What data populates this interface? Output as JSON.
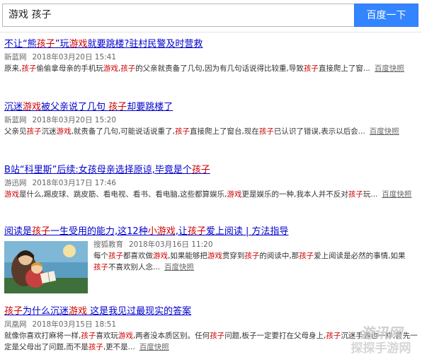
{
  "search": {
    "query": "游戏 孩子",
    "button_label": "百度一下"
  },
  "results": [
    {
      "title_parts": [
        "不让“熊",
        "孩子",
        "”玩",
        "游戏",
        "就要跳楼?驻村民警及时营救"
      ],
      "source": "新蓝网",
      "date": "2018年03月20日 15:41",
      "desc_parts": [
        "原来,",
        "孩子",
        "偷偷拿母亲的手机玩",
        "游戏",
        ",",
        "孩子",
        "的父亲就责备了几句,因为有几句话说得比较重,导致",
        "孩子",
        "直接爬上了窗..."
      ],
      "snapshot": "百度快照"
    },
    {
      "title_parts": [
        "沉迷",
        "游戏",
        "被父亲说了几句 ",
        "孩子",
        "却要跳楼了"
      ],
      "source": "新蓝网",
      "date": "2018年03月20日 15:20",
      "desc_parts": [
        "父亲见",
        "孩子",
        "沉迷",
        "游戏",
        ",就责备了几句,可能说话说重了,",
        "孩子",
        "直接爬上了窗台,现在",
        "孩子",
        "已认识了错误,表示以后会..."
      ],
      "snapshot": "百度快照"
    },
    {
      "title_parts": [
        "B站“科里斯”后续:女孩母亲选择原谅,毕竟是个",
        "孩子"
      ],
      "source": "游迅网",
      "date": "2018年03月17日 17:46",
      "desc_parts": [
        "游戏",
        "是什么,踢皮球、跳皮筋、看电视、看书、看电脑,这些都算娱乐,",
        "游戏",
        "更是娱乐的一种,我本人并不反对",
        "孩子",
        "玩..."
      ],
      "snapshot": "百度快照"
    },
    {
      "title_parts": [
        "阅读是",
        "孩子",
        "一生受用的能力,这12种",
        "小游戏",
        ",让",
        "孩子",
        "爱上阅读 | 方法指导"
      ],
      "source": "搜狐教育",
      "date": "2018年03月16日 11:20",
      "desc_parts": [
        "每个",
        "孩子",
        "都喜欢做",
        "游戏",
        ",如果能够把",
        "游戏",
        "贯穿到",
        "孩子",
        "的阅读中,那",
        "孩子",
        "爱上阅读是必然的事情,如果",
        "孩子",
        "不喜欢别人念..."
      ],
      "snapshot": "百度快照"
    },
    {
      "title_parts": [
        "孩子",
        "为什么沉迷",
        "游戏",
        " 这是我见过最现实的答案"
      ],
      "source": "凤凰网",
      "date": "2018年03月15日 18:51",
      "desc_parts": [
        "就像你喜欢打麻将一样,",
        "孩子",
        "喜欢玩",
        "游戏",
        ",两者没本质区别。任何",
        "孩子",
        "问题,板子一定要打在父母身上,",
        "孩子",
        "沉迷手游也一样,首先一定是父母出了问题,而不是",
        "孩子",
        ",更不是..."
      ],
      "snapshot": "百度快照"
    }
  ],
  "watermark": {
    "top": "游讯网",
    "bottom": "探探手游网"
  },
  "colors": {
    "button": "#3385ff",
    "title_link": "#0000cc",
    "highlight": "#cc0000"
  }
}
